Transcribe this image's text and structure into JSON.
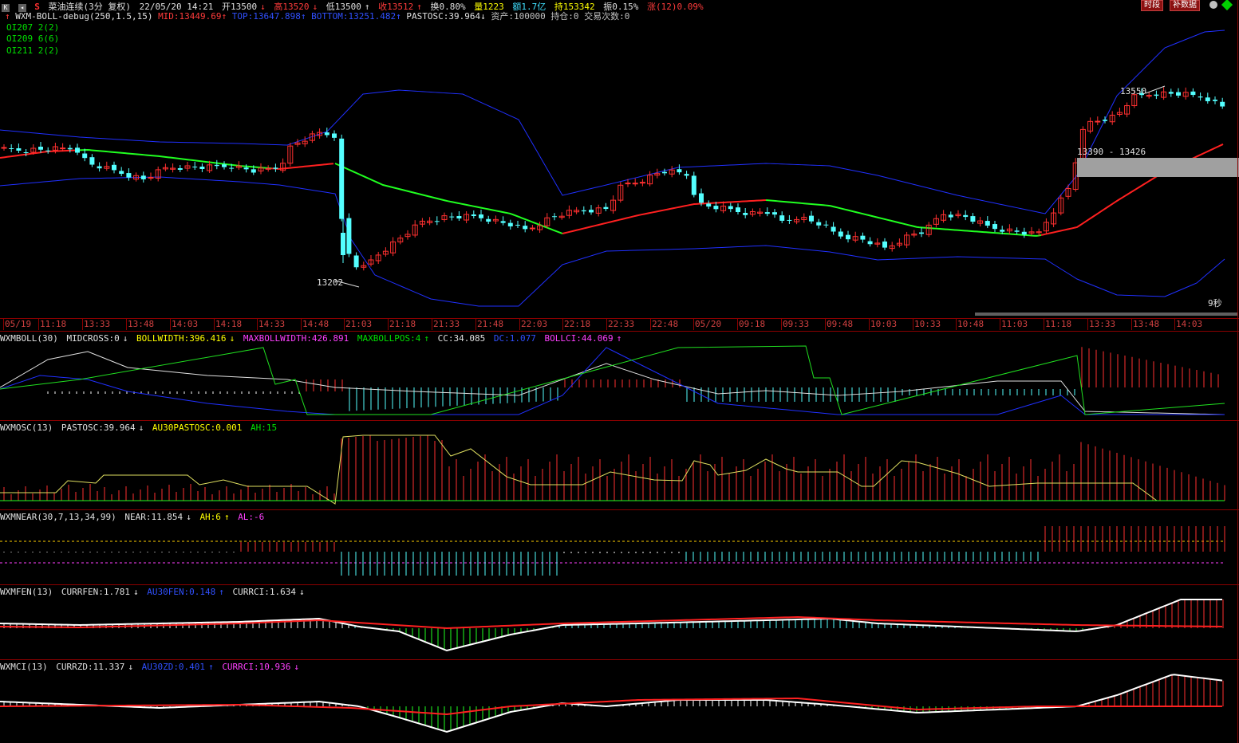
{
  "header": {
    "title": "菜油连续(3分 复权)",
    "datetime": "22/05/20 14:21",
    "open": "开13500",
    "high": "高13520",
    "low": "低13500",
    "close": "收13512",
    "turnover": "换0.80%",
    "volume": "量1223",
    "amount": "额1.7亿",
    "position": "持153342",
    "amplitude": "振0.15%",
    "change": "涨(12)0.09%",
    "btn_period": "时段",
    "btn_fill": "补数据"
  },
  "main": {
    "indicator_name": "WXM-BOLL-debug(250,1.5,15)",
    "mid": "MID:13449.69",
    "top": "TOP:13647.898",
    "bottom": "BOTTOM:13251.482",
    "pastosc": "PASTOSC:39.964",
    "assets": "资产:100000",
    "holding": "持仓:0",
    "trades": "交易次数:0",
    "oi": [
      "OI207  2(2)",
      "OI209  6(6)",
      "OI211  2(2)"
    ],
    "high_label": "13550",
    "low_label": "13202",
    "range_label": "13390 - 13426",
    "timer": "9秒"
  },
  "time_axis": [
    "05/19",
    "11:18",
    "13:33",
    "13:48",
    "14:03",
    "14:18",
    "14:33",
    "14:48",
    "21:03",
    "21:18",
    "21:33",
    "21:48",
    "22:03",
    "22:18",
    "22:33",
    "22:48",
    "05/20",
    "09:18",
    "09:33",
    "09:48",
    "10:03",
    "10:33",
    "10:48",
    "11:03",
    "11:18",
    "13:33",
    "13:48",
    "14:03"
  ],
  "panels": {
    "boll": {
      "name": "WXMBOLL(30)",
      "midcross": "MIDCROSS:0",
      "bollwidth": "BOLLWIDTH:396.416",
      "maxbollwidth": "MAXBOLLWIDTH:426.891",
      "maxbollpos": "MAXBOLLPOS:4",
      "cc": "CC:34.085",
      "dc": "DC:1.077",
      "bollci": "BOLLCI:44.069"
    },
    "osc": {
      "name": "WXMOSC(13)",
      "pastosc": "PASTOSC:39.964",
      "au30": "AU30PASTOSC:0.001",
      "ah": "AH:15"
    },
    "near": {
      "name": "WXMNEAR(30,7,13,34,99)",
      "near": "NEAR:11.854",
      "ah": "AH:6",
      "al": "AL:-6"
    },
    "fen": {
      "name": "WXMFEN(13)",
      "currfen": "CURRFEN:1.781",
      "au30fen": "AU30FEN:0.148",
      "currci": "CURRCI:1.634"
    },
    "ci": {
      "name": "WXMCI(13)",
      "currzd": "CURRZD:11.337",
      "au30zd": "AU30ZD:0.401",
      "currci": "CURRCI:10.936"
    }
  },
  "colors": {
    "up": "#ff3030",
    "down": "#54ffff",
    "mid_up": "#ff2020",
    "mid_down": "#20ff20",
    "band": "#2030ff",
    "grid": "#8b0000"
  }
}
